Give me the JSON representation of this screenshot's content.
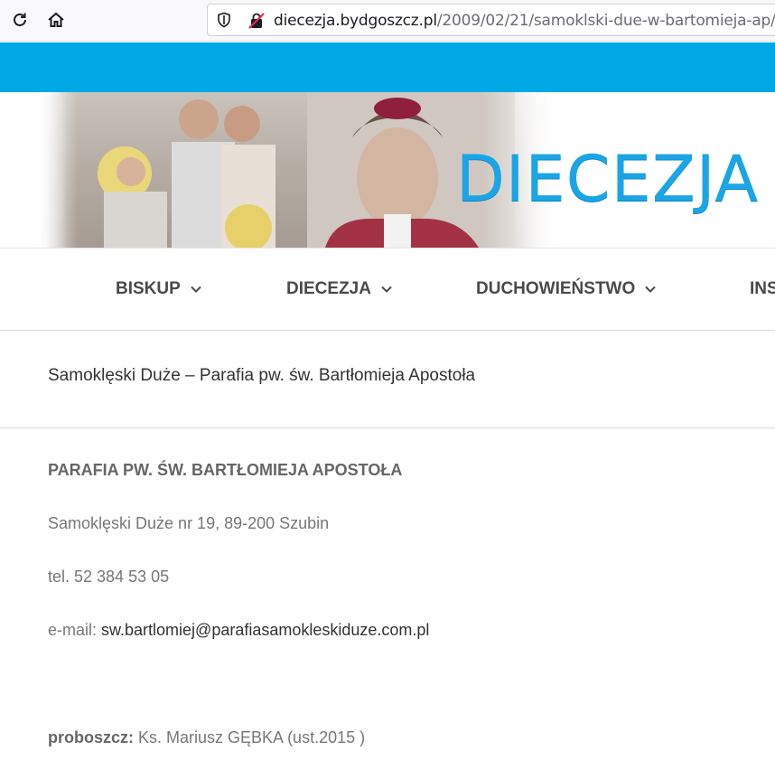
{
  "browser": {
    "url_host": "diecezja.bydgoszcz.pl",
    "url_path": "/2009/02/21/samoklski-due-w-bartomieja-ap/"
  },
  "site": {
    "brand": "DIECEZJA B",
    "accent_color": "#00a8e6"
  },
  "nav": {
    "items": [
      {
        "label": "BISKUP"
      },
      {
        "label": "DIECEZJA"
      },
      {
        "label": "DUCHOWIEŃSTWO"
      },
      {
        "label": "INS"
      }
    ]
  },
  "page": {
    "title": "Samoklęski Duże – Parafia pw. św. Bartłomieja Apostoła"
  },
  "content": {
    "heading": "PARAFIA PW. ŚW. BARTŁOMIEJA APOSTOŁA",
    "address": "Samoklęski Duże nr 19, 89-200 Szubin",
    "tel": "tel. 52 384 53 05",
    "email_label": "e-mail: ",
    "email": "sw.bartlomiej@parafiasamokleskiduze.com.pl",
    "pastor_label": "proboszcz:",
    "pastor": " Ks. Mariusz GĘBKA (ust.2015 )"
  }
}
